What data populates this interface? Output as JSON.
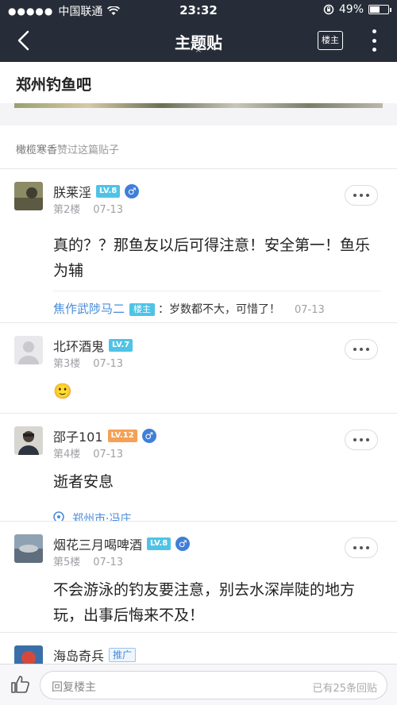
{
  "status_bar": {
    "carrier": "中国联通",
    "time": "23:32",
    "battery": "49%",
    "battery_level": 0.49
  },
  "nav": {
    "title": "主题贴",
    "louzhu_label": "楼主"
  },
  "forum": {
    "name": "郑州钓鱼吧"
  },
  "liked": {
    "user": "橄榄寒香",
    "text": "赞过这篇贴子"
  },
  "posts": [
    {
      "username": "朕莱淫",
      "level": "LV.8",
      "floor": "第2楼",
      "date": "07-13",
      "content": "真的？？那鱼友以后可得注意！安全第一！鱼乐为辅",
      "reply": {
        "name": "焦作武陟马二",
        "tag": "楼主",
        "text": "：岁数都不大，可惜了！",
        "time": "07-13"
      }
    },
    {
      "username": "北环酒鬼",
      "level": "LV.7",
      "floor": "第3楼",
      "date": "07-13",
      "content": "🙂"
    },
    {
      "username": "邵子101",
      "level": "LV.12",
      "floor": "第4楼",
      "date": "07-13",
      "content": "逝者安息",
      "location": "郑州市·冯庄"
    },
    {
      "username": "烟花三月喝啤酒",
      "level": "LV.8",
      "floor": "第5楼",
      "date": "07-13",
      "content": "不会游泳的钓友要注意，别去水深岸陡的地方玩，出事后悔来不及！"
    },
    {
      "username": "海岛奇兵",
      "tag": "推广"
    }
  ],
  "bottom": {
    "placeholder": "回复楼主",
    "count": "已有25条回贴"
  }
}
